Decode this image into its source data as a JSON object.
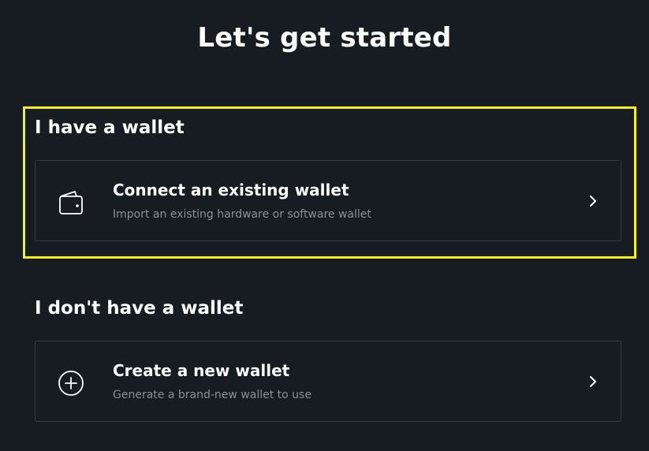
{
  "page": {
    "title": "Let's get started"
  },
  "sections": [
    {
      "heading": "I have a wallet",
      "card": {
        "title": "Connect an existing wallet",
        "description": "Import an existing hardware or software wallet",
        "icon": "wallet-icon"
      }
    },
    {
      "heading": "I don't have a wallet",
      "card": {
        "title": "Create a new wallet",
        "description": "Generate a brand-new wallet to use",
        "icon": "plus-circle-icon"
      }
    }
  ],
  "colors": {
    "background": "#171b22",
    "highlight": "#f9f013",
    "card_border": "#343a44",
    "muted_text": "#8a9099"
  }
}
